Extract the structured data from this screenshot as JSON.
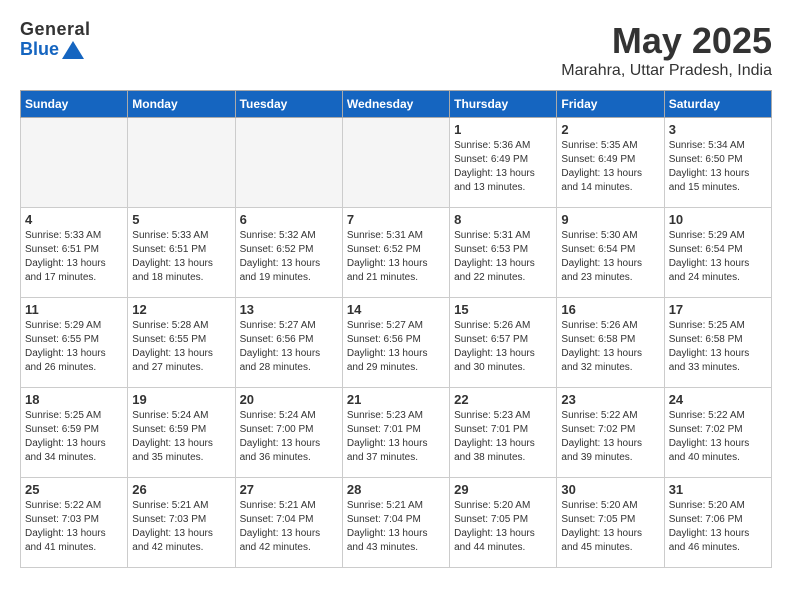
{
  "header": {
    "logo_general": "General",
    "logo_blue": "Blue",
    "month_title": "May 2025",
    "location": "Marahra, Uttar Pradesh, India"
  },
  "weekdays": [
    "Sunday",
    "Monday",
    "Tuesday",
    "Wednesday",
    "Thursday",
    "Friday",
    "Saturday"
  ],
  "weeks": [
    [
      {
        "day": "",
        "info": ""
      },
      {
        "day": "",
        "info": ""
      },
      {
        "day": "",
        "info": ""
      },
      {
        "day": "",
        "info": ""
      },
      {
        "day": "1",
        "info": "Sunrise: 5:36 AM\nSunset: 6:49 PM\nDaylight: 13 hours\nand 13 minutes."
      },
      {
        "day": "2",
        "info": "Sunrise: 5:35 AM\nSunset: 6:49 PM\nDaylight: 13 hours\nand 14 minutes."
      },
      {
        "day": "3",
        "info": "Sunrise: 5:34 AM\nSunset: 6:50 PM\nDaylight: 13 hours\nand 15 minutes."
      }
    ],
    [
      {
        "day": "4",
        "info": "Sunrise: 5:33 AM\nSunset: 6:51 PM\nDaylight: 13 hours\nand 17 minutes."
      },
      {
        "day": "5",
        "info": "Sunrise: 5:33 AM\nSunset: 6:51 PM\nDaylight: 13 hours\nand 18 minutes."
      },
      {
        "day": "6",
        "info": "Sunrise: 5:32 AM\nSunset: 6:52 PM\nDaylight: 13 hours\nand 19 minutes."
      },
      {
        "day": "7",
        "info": "Sunrise: 5:31 AM\nSunset: 6:52 PM\nDaylight: 13 hours\nand 21 minutes."
      },
      {
        "day": "8",
        "info": "Sunrise: 5:31 AM\nSunset: 6:53 PM\nDaylight: 13 hours\nand 22 minutes."
      },
      {
        "day": "9",
        "info": "Sunrise: 5:30 AM\nSunset: 6:54 PM\nDaylight: 13 hours\nand 23 minutes."
      },
      {
        "day": "10",
        "info": "Sunrise: 5:29 AM\nSunset: 6:54 PM\nDaylight: 13 hours\nand 24 minutes."
      }
    ],
    [
      {
        "day": "11",
        "info": "Sunrise: 5:29 AM\nSunset: 6:55 PM\nDaylight: 13 hours\nand 26 minutes."
      },
      {
        "day": "12",
        "info": "Sunrise: 5:28 AM\nSunset: 6:55 PM\nDaylight: 13 hours\nand 27 minutes."
      },
      {
        "day": "13",
        "info": "Sunrise: 5:27 AM\nSunset: 6:56 PM\nDaylight: 13 hours\nand 28 minutes."
      },
      {
        "day": "14",
        "info": "Sunrise: 5:27 AM\nSunset: 6:56 PM\nDaylight: 13 hours\nand 29 minutes."
      },
      {
        "day": "15",
        "info": "Sunrise: 5:26 AM\nSunset: 6:57 PM\nDaylight: 13 hours\nand 30 minutes."
      },
      {
        "day": "16",
        "info": "Sunrise: 5:26 AM\nSunset: 6:58 PM\nDaylight: 13 hours\nand 32 minutes."
      },
      {
        "day": "17",
        "info": "Sunrise: 5:25 AM\nSunset: 6:58 PM\nDaylight: 13 hours\nand 33 minutes."
      }
    ],
    [
      {
        "day": "18",
        "info": "Sunrise: 5:25 AM\nSunset: 6:59 PM\nDaylight: 13 hours\nand 34 minutes."
      },
      {
        "day": "19",
        "info": "Sunrise: 5:24 AM\nSunset: 6:59 PM\nDaylight: 13 hours\nand 35 minutes."
      },
      {
        "day": "20",
        "info": "Sunrise: 5:24 AM\nSunset: 7:00 PM\nDaylight: 13 hours\nand 36 minutes."
      },
      {
        "day": "21",
        "info": "Sunrise: 5:23 AM\nSunset: 7:01 PM\nDaylight: 13 hours\nand 37 minutes."
      },
      {
        "day": "22",
        "info": "Sunrise: 5:23 AM\nSunset: 7:01 PM\nDaylight: 13 hours\nand 38 minutes."
      },
      {
        "day": "23",
        "info": "Sunrise: 5:22 AM\nSunset: 7:02 PM\nDaylight: 13 hours\nand 39 minutes."
      },
      {
        "day": "24",
        "info": "Sunrise: 5:22 AM\nSunset: 7:02 PM\nDaylight: 13 hours\nand 40 minutes."
      }
    ],
    [
      {
        "day": "25",
        "info": "Sunrise: 5:22 AM\nSunset: 7:03 PM\nDaylight: 13 hours\nand 41 minutes."
      },
      {
        "day": "26",
        "info": "Sunrise: 5:21 AM\nSunset: 7:03 PM\nDaylight: 13 hours\nand 42 minutes."
      },
      {
        "day": "27",
        "info": "Sunrise: 5:21 AM\nSunset: 7:04 PM\nDaylight: 13 hours\nand 42 minutes."
      },
      {
        "day": "28",
        "info": "Sunrise: 5:21 AM\nSunset: 7:04 PM\nDaylight: 13 hours\nand 43 minutes."
      },
      {
        "day": "29",
        "info": "Sunrise: 5:20 AM\nSunset: 7:05 PM\nDaylight: 13 hours\nand 44 minutes."
      },
      {
        "day": "30",
        "info": "Sunrise: 5:20 AM\nSunset: 7:05 PM\nDaylight: 13 hours\nand 45 minutes."
      },
      {
        "day": "31",
        "info": "Sunrise: 5:20 AM\nSunset: 7:06 PM\nDaylight: 13 hours\nand 46 minutes."
      }
    ]
  ]
}
